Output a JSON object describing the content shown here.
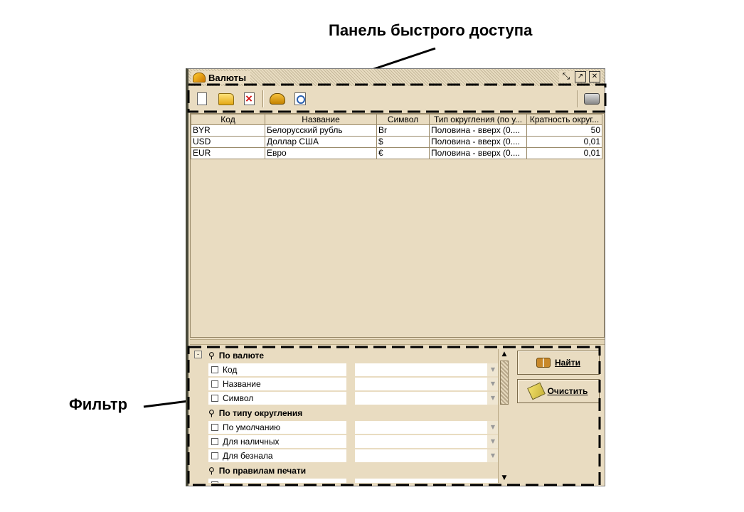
{
  "annotations": {
    "quick_access": "Панель быстрого доступа",
    "filter": "Фильтр"
  },
  "window": {
    "title": "Валюты",
    "title_icon": "currency-app-icon",
    "buttons": [
      "restore-icon",
      "maximize-icon",
      "close-icon"
    ]
  },
  "toolbar": {
    "buttons": [
      {
        "icon": "new-document-icon"
      },
      {
        "icon": "open-folder-icon"
      },
      {
        "icon": "delete-icon"
      },
      {
        "icon": "edit-icon"
      },
      {
        "icon": "view-icon"
      },
      {
        "icon": "print-icon"
      }
    ]
  },
  "grid": {
    "columns": [
      "Код",
      "Название",
      "Символ",
      "Тип округления (по у...",
      "Кратность округ..."
    ],
    "rows": [
      [
        "BYR",
        "Белорусский рубль",
        "Br",
        "Половина - вверх (0....",
        "50"
      ],
      [
        "USD",
        "Доллар США",
        "$",
        "Половина - вверх (0....",
        "0,01"
      ],
      [
        "EUR",
        "Евро",
        "€",
        "Половина - вверх (0....",
        "0,01"
      ]
    ]
  },
  "filter": {
    "groups": [
      {
        "label": "По валюте",
        "items": [
          "Код",
          "Название",
          "Символ"
        ]
      },
      {
        "label": "По типу округления",
        "items": [
          "По умолчанию",
          "Для наличных",
          "Для безнала"
        ]
      },
      {
        "label": "По правилам печати",
        "items": []
      }
    ],
    "find_label": "Найти",
    "clear_label": "Очистить"
  }
}
